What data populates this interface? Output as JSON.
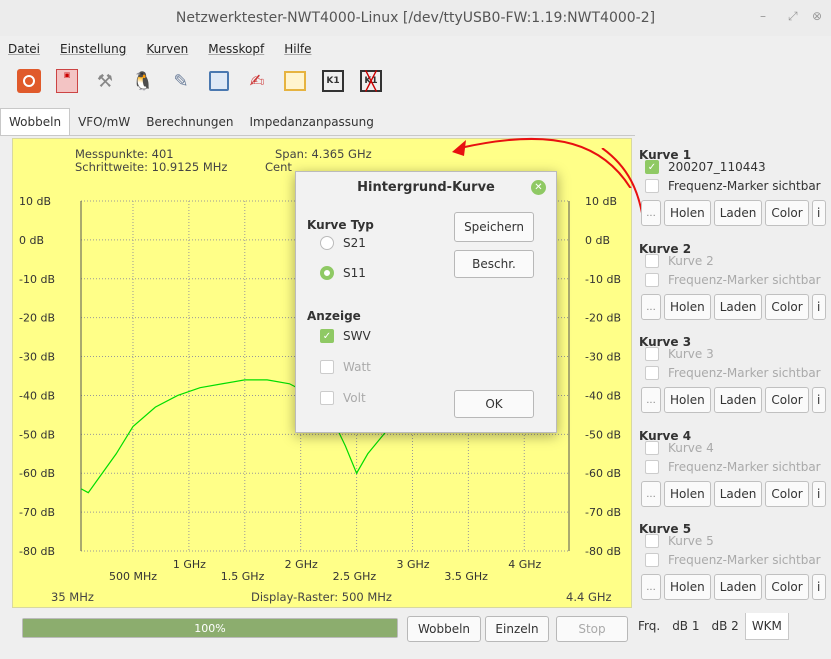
{
  "window": {
    "title": "Netzwerktester-NWT4000-Linux [/dev/ttyUSB0-FW:1.19:NWT4000-2]"
  },
  "menu": [
    "Datei",
    "Einstellung",
    "Kurven",
    "Messkopf",
    "Hilfe"
  ],
  "toolbar_icons": [
    "power-icon",
    "png-bmp-icon",
    "tools-icon",
    "linux-penguin-icon",
    "pencil-icon",
    "save-icon",
    "edit-doc-icon",
    "calendar-icon",
    "k1-icon",
    "k1-crossed-icon"
  ],
  "tabs": [
    "Wobbeln",
    "VFO/mW",
    "Berechnungen",
    "Impedanzanpassung"
  ],
  "plot": {
    "info_left1": "Messpunkte: 401",
    "info_left2": "Schrittweite: 10.9125 MHz",
    "info_span": "Span: 4.365 GHz",
    "info_center": "Cent",
    "y_labels": [
      "10 dB",
      "0 dB",
      "-10 dB",
      "-20 dB",
      "-30 dB",
      "-40 dB",
      "-50 dB",
      "-60 dB",
      "-70 dB",
      "-80 dB"
    ],
    "x_labels_upper": [
      "1 GHz",
      "2 GHz",
      "3 GHz",
      "4 GHz"
    ],
    "x_labels_lower": [
      "500 MHz",
      "1.5 GHz",
      "2.5 GHz",
      "3.5 GHz"
    ],
    "x_start": "35 MHz",
    "x_end": "4.4 GHz",
    "raster": "Display-Raster: 500 MHz",
    "trace_color": "#00dd00",
    "bg_color": "#ffff88"
  },
  "chart_data": {
    "type": "line",
    "xlim": [
      0.035,
      4.4
    ],
    "ylim": [
      -85,
      12
    ],
    "series": [
      {
        "x": [
          0.035,
          0.1,
          0.2,
          0.35,
          0.5,
          0.7,
          0.9,
          1.1,
          1.3,
          1.5,
          1.7,
          1.9,
          2.1,
          2.2,
          2.3,
          2.4,
          2.5,
          2.6,
          2.8,
          3.0
        ],
        "y": [
          -64,
          -65,
          -61,
          -55,
          -48,
          -43,
          -40,
          -38,
          -37,
          -36,
          -36,
          -37,
          -40,
          -44,
          -47,
          -53,
          -60,
          -55,
          -48,
          -44
        ]
      }
    ]
  },
  "dialog": {
    "title": "Hintergrund-Kurve",
    "group_typ": "Kurve Typ",
    "opt_s21": "S21",
    "opt_s11": "S11",
    "group_anzeige": "Anzeige",
    "opt_swv": "SWV",
    "opt_watt": "Watt",
    "opt_volt": "Volt",
    "btn_save": "Speichern",
    "btn_desc": "Beschr.",
    "btn_ok": "OK"
  },
  "curves": [
    {
      "title": "Kurve 1",
      "name": "200207_110443",
      "marker": "Frequenz-Marker sichtbar"
    },
    {
      "title": "Kurve 2",
      "name": "Kurve 2",
      "marker": "Frequenz-Marker sichtbar"
    },
    {
      "title": "Kurve 3",
      "name": "Kurve 3",
      "marker": "Frequenz-Marker sichtbar"
    },
    {
      "title": "Kurve 4",
      "name": "Kurve 4",
      "marker": "Frequenz-Marker sichtbar"
    },
    {
      "title": "Kurve 5",
      "name": "Kurve 5",
      "marker": "Frequenz-Marker sichtbar"
    }
  ],
  "curve_buttons": {
    "dots": "...",
    "holen": "Holen",
    "laden": "Laden",
    "color": "Color",
    "info": "i"
  },
  "bottom": {
    "progress_text": "100%",
    "progress_value": 1.0,
    "btn_wobbeln": "Wobbeln",
    "btn_einzeln": "Einzeln",
    "btn_stop": "Stop",
    "tabs": [
      "Frq.",
      "dB 1",
      "dB 2",
      "WKM"
    ]
  }
}
